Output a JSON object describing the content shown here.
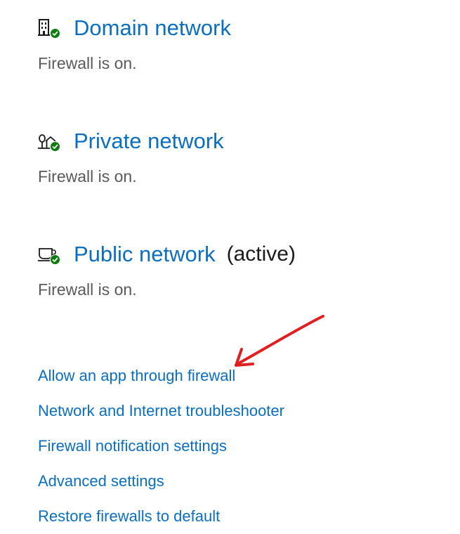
{
  "networks": [
    {
      "icon": "building-icon",
      "title": "Domain network",
      "active": "",
      "status": "Firewall is on."
    },
    {
      "icon": "home-network-icon",
      "title": "Private network",
      "active": "",
      "status": "Firewall is on."
    },
    {
      "icon": "coffee-cup-icon",
      "title": "Public network",
      "active": "(active)",
      "status": "Firewall is on."
    }
  ],
  "links": [
    "Allow an app through firewall",
    "Network and Internet troubleshooter",
    "Firewall notification settings",
    "Advanced settings",
    "Restore firewalls to default"
  ],
  "colors": {
    "link": "#0a6fc2",
    "status_ok": "#0f7b0f",
    "annotation_arrow": "#e02020"
  }
}
